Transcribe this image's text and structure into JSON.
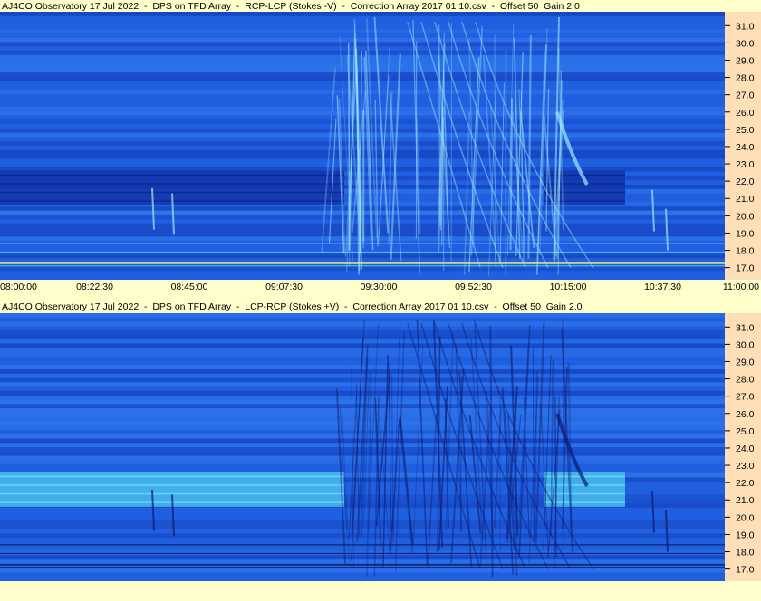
{
  "panels": [
    {
      "title": "AJ4CO Observatory 17 Jul 2022  -  DPS on TFD Array  -  RCP-LCP (Stokes -V)  -  Correction Array 2017 01 10.csv  -  Offset 50  Gain 2.0"
    },
    {
      "title": "AJ4CO Observatory 17 Jul 2022  -  DPS on TFD Array  -  LCP-RCP (Stokes +V)  -  Correction Array 2017 01 10.csv  -  Offset 50  Gain 2.0"
    }
  ],
  "time_axis": [
    "08:00:00",
    "08:22:30",
    "08:45:00",
    "09:07:30",
    "09:30:00",
    "09:52:30",
    "10:15:00",
    "10:37:30",
    "11:00:00"
  ],
  "colors": {
    "background": "#ffffcc",
    "freq_axis_bg": "#ffdfb8"
  },
  "chart_data": [
    {
      "type": "heatmap",
      "title": "AJ4CO Observatory 17 Jul 2022  -  DPS on TFD Array  -  RCP-LCP (Stokes -V)  -  Correction Array 2017 01 10.csv  -  Offset 50  Gain 2.0",
      "xlabel": "",
      "ylabel": "",
      "x_ticks": [
        "08:00:00",
        "08:22:30",
        "08:45:00",
        "09:07:30",
        "09:30:00",
        "09:52:30",
        "10:15:00",
        "10:37:30",
        "11:00:00"
      ],
      "y_ticks": [
        "31.0",
        "30.0",
        "29.0",
        "28.0",
        "27.0",
        "26.0",
        "25.0",
        "24.0",
        "23.0",
        "22.0",
        "21.0",
        "20.0",
        "19.0",
        "18.0",
        "17.0"
      ],
      "y_range_mhz": [
        16.3,
        31.8
      ],
      "colormap": "blue",
      "polarity": -1
    },
    {
      "type": "heatmap",
      "title": "AJ4CO Observatory 17 Jul 2022  -  DPS on TFD Array  -  LCP-RCP (Stokes +V)  -  Correction Array 2017 01 10.csv  -  Offset 50  Gain 2.0",
      "xlabel": "",
      "ylabel": "",
      "x_ticks": [],
      "y_ticks": [
        "31.0",
        "30.0",
        "29.0",
        "28.0",
        "27.0",
        "26.0",
        "25.0",
        "24.0",
        "23.0",
        "22.0",
        "21.0",
        "20.0",
        "19.0",
        "18.0",
        "17.0"
      ],
      "y_range_mhz": [
        16.3,
        31.8
      ],
      "colormap": "blue",
      "polarity": 1
    }
  ]
}
